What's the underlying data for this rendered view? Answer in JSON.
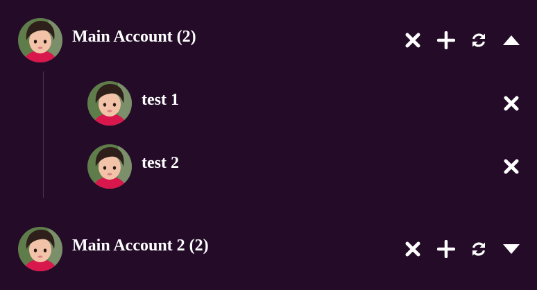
{
  "accounts": [
    {
      "name": "Main Account (2)",
      "expanded": true,
      "avatar": "child-portrait",
      "actions": [
        "close-icon",
        "plus-icon",
        "refresh-icon",
        "triangle-up-icon"
      ],
      "children": [
        {
          "name": "test 1",
          "avatar": "child-portrait",
          "actions": [
            "close-icon"
          ]
        },
        {
          "name": "test 2",
          "avatar": "child-portrait",
          "actions": [
            "close-icon"
          ]
        }
      ]
    },
    {
      "name": "Main Account 2 (2)",
      "expanded": false,
      "avatar": "child-portrait",
      "actions": [
        "close-icon",
        "plus-icon",
        "refresh-icon",
        "triangle-down-icon"
      ],
      "children": []
    }
  ],
  "colors": {
    "background": "#240c29",
    "text": "#ffffff",
    "tree_line": "#4a3350"
  }
}
